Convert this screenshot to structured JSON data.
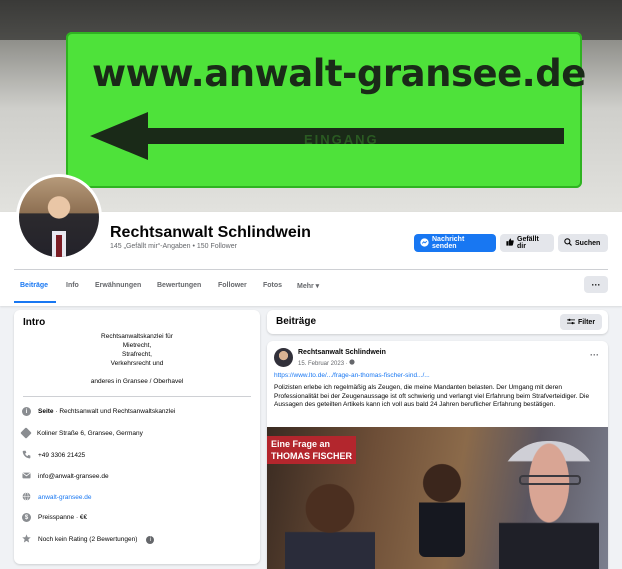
{
  "cover": {
    "sign_text": "www.anwalt-gransee.de",
    "sign_subtext": "EINGANG"
  },
  "profile": {
    "name": "Rechtsanwalt Schlindwein",
    "stats": "145 „Gefällt mir“-Angaben • 150 Follower"
  },
  "actions": {
    "message": "Nachricht senden",
    "like": "Gefällt dir",
    "search": "Suchen"
  },
  "tabs": [
    "Beiträge",
    "Info",
    "Erwähnungen",
    "Bewertungen",
    "Follower",
    "Fotos",
    "Mehr ▾"
  ],
  "more_menu": "···",
  "intro": {
    "title": "Intro",
    "bio_lines": [
      "Rechtsanwaltskanzlei für",
      "Mietrecht,",
      "Strafrecht,",
      "Verkehrsrecht und",
      "",
      "anderes in Gransee / Oberhavel"
    ],
    "page_label": "Seite",
    "page_category": " · Rechtsanwalt und Rechtsanwaltskanzlei",
    "address": "Koliner Straße 6, Gransee, Germany",
    "phone": "+49 3306 21425",
    "email": "info@anwalt-gransee.de",
    "website": "anwalt-gransee.de",
    "price": "Preisspanne · €€",
    "rating": "Noch kein Rating (2 Bewertungen)"
  },
  "posts": {
    "title": "Beiträge",
    "filter": "Filter"
  },
  "post": {
    "author": "Rechtsanwalt Schlindwein",
    "date": "15. Februar 2023 · ",
    "link": "https://www.lto.de/.../frage-an-thomas-fischer-sind.../...",
    "text": "Polizisten erlebe ich regelmäßig als Zeugen, die meine Mandanten belasten. Der Umgang mit deren Professionalität bei der Zeugenaussage ist oft  schwierig und verlangt viel Erfahrung beim Strafverteidiger. Die Aussagen des geteilten Artikels kann ich voll aus  bald 24 Jahren beruflicher Erfahrung bestätigen.",
    "image_title_1": "Eine Frage an",
    "image_title_2": "THOMAS FISCHER"
  },
  "colors": {
    "accent": "#1877f2",
    "sign_green": "#4ee23a",
    "image_banner": "#b3262d"
  },
  "icons": [
    "messenger-icon",
    "thumbs-up-icon",
    "search-icon",
    "info-icon",
    "map-pin-icon",
    "phone-icon",
    "email-icon",
    "globe-icon",
    "price-icon",
    "star-icon",
    "filter-icon",
    "globe-small-icon"
  ]
}
